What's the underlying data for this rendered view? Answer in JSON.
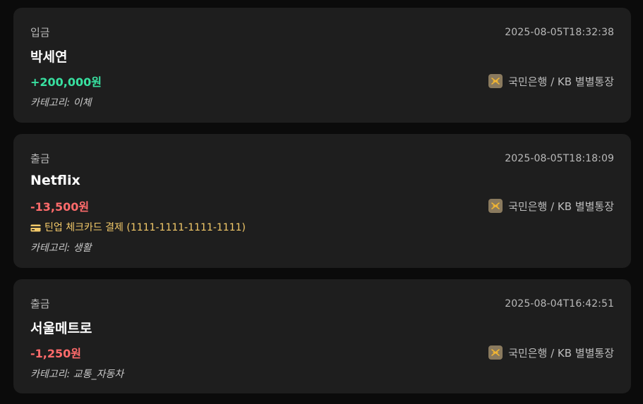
{
  "transactions": [
    {
      "kind": "입금",
      "time": "2025-08-05T18:32:38",
      "name": "박세연",
      "amount": "+200,000원",
      "amount_color": "#38e0a0",
      "bank": "국민은행 / KB 별별통장",
      "bank_icon": "kb-bank-icon",
      "category": "카테고리: 이체"
    },
    {
      "kind": "출금",
      "time": "2025-08-05T18:18:09",
      "name": "Netflix",
      "amount": "-13,500원",
      "amount_color": "#ff6b6b",
      "bank": "국민은행 / KB 별별통장",
      "bank_icon": "kb-bank-icon",
      "card": "틴업 체크카드 결제 (1111-1111-1111-1111)",
      "card_icon": "credit-card-icon",
      "category": "카테고리: 생활"
    },
    {
      "kind": "출금",
      "time": "2025-08-04T16:42:51",
      "name": "서울메트로",
      "amount": "-1,250원",
      "amount_color": "#ff6b6b",
      "bank": "국민은행 / KB 별별통장",
      "bank_icon": "kb-bank-icon",
      "category": "카테고리: 교통_자동차"
    }
  ]
}
